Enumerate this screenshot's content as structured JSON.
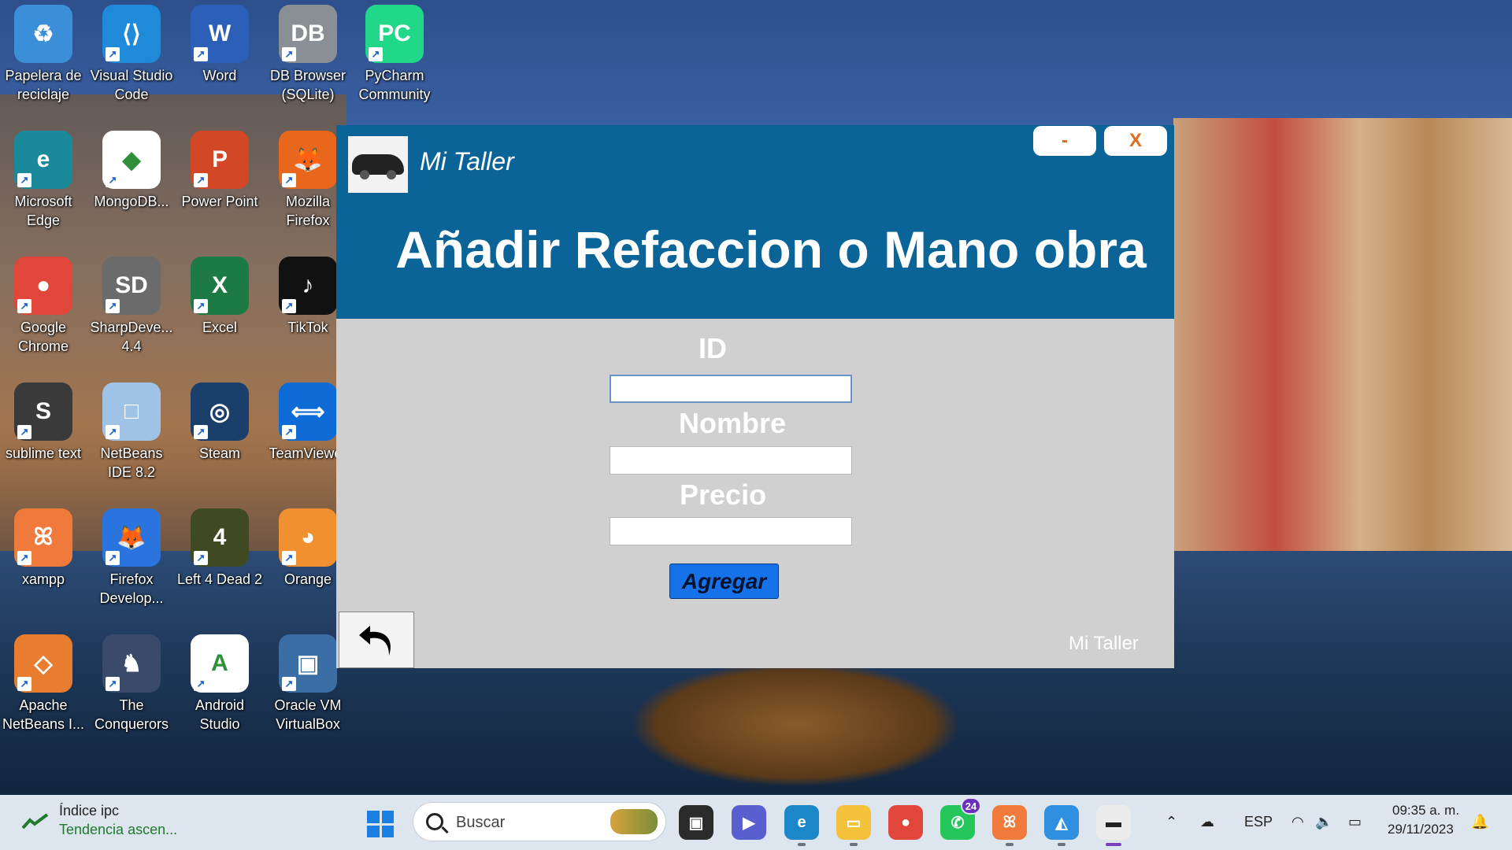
{
  "desktop": {
    "icons": [
      {
        "label": "Papelera de reciclaje",
        "color": "#3b8fd8",
        "glyph": "♻"
      },
      {
        "label": "Visual Studio Code",
        "color": "#1f8ad9",
        "glyph": "⟨⟩"
      },
      {
        "label": "Word",
        "color": "#2b5fb8",
        "glyph": "W"
      },
      {
        "label": "DB Browser (SQLite)",
        "color": "#8a8f96",
        "glyph": "DB"
      },
      {
        "label": "PyCharm Community",
        "color": "#21d789",
        "glyph": "PC"
      },
      {
        "label": "Microsoft Edge",
        "color": "#1a8a9b",
        "glyph": "e"
      },
      {
        "label": "MongoDB...",
        "color": "#ffffff",
        "glyph": "◆"
      },
      {
        "label": "Power Point",
        "color": "#d24726",
        "glyph": "P"
      },
      {
        "label": "Mozilla Firefox",
        "color": "#e8671d",
        "glyph": "🦊"
      },
      {
        "label": "Google Chrome",
        "color": "#e0463a",
        "glyph": "●"
      },
      {
        "label": "SharpDeve... 4.4",
        "color": "#6b6b6b",
        "glyph": "SD"
      },
      {
        "label": "Excel",
        "color": "#1d7a45",
        "glyph": "X"
      },
      {
        "label": "TikTok",
        "color": "#111111",
        "glyph": "♪"
      },
      {
        "label": "sublime text",
        "color": "#3a3a3a",
        "glyph": "S"
      },
      {
        "label": "NetBeans IDE 8.2",
        "color": "#9fc3e6",
        "glyph": "□"
      },
      {
        "label": "Steam",
        "color": "#1b3f6b",
        "glyph": "◎"
      },
      {
        "label": "TeamViewer",
        "color": "#0e6bd6",
        "glyph": "⟺"
      },
      {
        "label": "xampp",
        "color": "#f07a3c",
        "glyph": "ꕤ"
      },
      {
        "label": "Firefox Develop...",
        "color": "#2a74e0",
        "glyph": "🦊"
      },
      {
        "label": "Left 4 Dead 2",
        "color": "#3f4a22",
        "glyph": "4"
      },
      {
        "label": "Orange",
        "color": "#f09030",
        "glyph": "◕"
      },
      {
        "label": "Apache NetBeans I...",
        "color": "#e97d2f",
        "glyph": "◇"
      },
      {
        "label": "The Conquerors",
        "color": "#3a4a6a",
        "glyph": "♞"
      },
      {
        "label": "Android Studio",
        "color": "#ffffff",
        "glyph": "A"
      },
      {
        "label": "Oracle VM VirtualBox",
        "color": "#3a6ea5",
        "glyph": "▣"
      }
    ]
  },
  "window": {
    "app_name": "Mi Taller",
    "minimize_label": "-",
    "close_label": "X",
    "heading": "Añadir Refaccion o Mano obra",
    "fields": {
      "id_label": "ID",
      "id_value": "",
      "nombre_label": "Nombre",
      "nombre_value": "",
      "precio_label": "Precio",
      "precio_value": ""
    },
    "add_button": "Agregar",
    "footer_brand": "Mi Taller"
  },
  "taskbar": {
    "widget_title": "Índice ipc",
    "widget_subtitle": "Tendencia ascen...",
    "search_placeholder": "Buscar",
    "whatsapp_badge": "24",
    "language": "ESP",
    "time": "09:35 a. m.",
    "date": "29/11/2023"
  }
}
